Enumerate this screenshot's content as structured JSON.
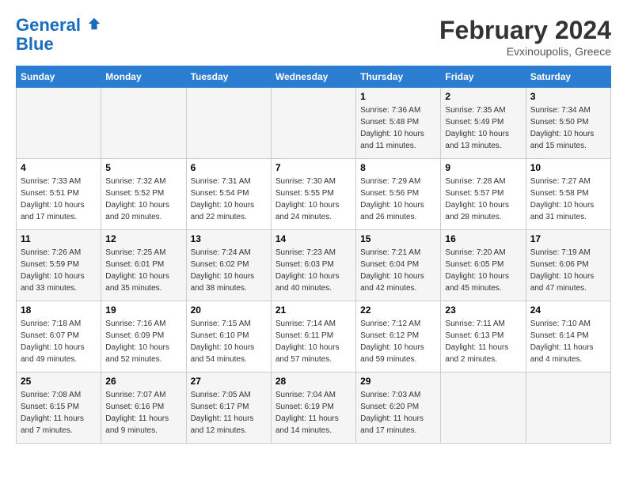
{
  "header": {
    "logo_line1": "General",
    "logo_line2": "Blue",
    "month_title": "February 2024",
    "location": "Evxinoupolis, Greece"
  },
  "weekdays": [
    "Sunday",
    "Monday",
    "Tuesday",
    "Wednesday",
    "Thursday",
    "Friday",
    "Saturday"
  ],
  "weeks": [
    [
      {
        "day": "",
        "info": ""
      },
      {
        "day": "",
        "info": ""
      },
      {
        "day": "",
        "info": ""
      },
      {
        "day": "",
        "info": ""
      },
      {
        "day": "1",
        "info": "Sunrise: 7:36 AM\nSunset: 5:48 PM\nDaylight: 10 hours\nand 11 minutes."
      },
      {
        "day": "2",
        "info": "Sunrise: 7:35 AM\nSunset: 5:49 PM\nDaylight: 10 hours\nand 13 minutes."
      },
      {
        "day": "3",
        "info": "Sunrise: 7:34 AM\nSunset: 5:50 PM\nDaylight: 10 hours\nand 15 minutes."
      }
    ],
    [
      {
        "day": "4",
        "info": "Sunrise: 7:33 AM\nSunset: 5:51 PM\nDaylight: 10 hours\nand 17 minutes."
      },
      {
        "day": "5",
        "info": "Sunrise: 7:32 AM\nSunset: 5:52 PM\nDaylight: 10 hours\nand 20 minutes."
      },
      {
        "day": "6",
        "info": "Sunrise: 7:31 AM\nSunset: 5:54 PM\nDaylight: 10 hours\nand 22 minutes."
      },
      {
        "day": "7",
        "info": "Sunrise: 7:30 AM\nSunset: 5:55 PM\nDaylight: 10 hours\nand 24 minutes."
      },
      {
        "day": "8",
        "info": "Sunrise: 7:29 AM\nSunset: 5:56 PM\nDaylight: 10 hours\nand 26 minutes."
      },
      {
        "day": "9",
        "info": "Sunrise: 7:28 AM\nSunset: 5:57 PM\nDaylight: 10 hours\nand 28 minutes."
      },
      {
        "day": "10",
        "info": "Sunrise: 7:27 AM\nSunset: 5:58 PM\nDaylight: 10 hours\nand 31 minutes."
      }
    ],
    [
      {
        "day": "11",
        "info": "Sunrise: 7:26 AM\nSunset: 5:59 PM\nDaylight: 10 hours\nand 33 minutes."
      },
      {
        "day": "12",
        "info": "Sunrise: 7:25 AM\nSunset: 6:01 PM\nDaylight: 10 hours\nand 35 minutes."
      },
      {
        "day": "13",
        "info": "Sunrise: 7:24 AM\nSunset: 6:02 PM\nDaylight: 10 hours\nand 38 minutes."
      },
      {
        "day": "14",
        "info": "Sunrise: 7:23 AM\nSunset: 6:03 PM\nDaylight: 10 hours\nand 40 minutes."
      },
      {
        "day": "15",
        "info": "Sunrise: 7:21 AM\nSunset: 6:04 PM\nDaylight: 10 hours\nand 42 minutes."
      },
      {
        "day": "16",
        "info": "Sunrise: 7:20 AM\nSunset: 6:05 PM\nDaylight: 10 hours\nand 45 minutes."
      },
      {
        "day": "17",
        "info": "Sunrise: 7:19 AM\nSunset: 6:06 PM\nDaylight: 10 hours\nand 47 minutes."
      }
    ],
    [
      {
        "day": "18",
        "info": "Sunrise: 7:18 AM\nSunset: 6:07 PM\nDaylight: 10 hours\nand 49 minutes."
      },
      {
        "day": "19",
        "info": "Sunrise: 7:16 AM\nSunset: 6:09 PM\nDaylight: 10 hours\nand 52 minutes."
      },
      {
        "day": "20",
        "info": "Sunrise: 7:15 AM\nSunset: 6:10 PM\nDaylight: 10 hours\nand 54 minutes."
      },
      {
        "day": "21",
        "info": "Sunrise: 7:14 AM\nSunset: 6:11 PM\nDaylight: 10 hours\nand 57 minutes."
      },
      {
        "day": "22",
        "info": "Sunrise: 7:12 AM\nSunset: 6:12 PM\nDaylight: 10 hours\nand 59 minutes."
      },
      {
        "day": "23",
        "info": "Sunrise: 7:11 AM\nSunset: 6:13 PM\nDaylight: 11 hours\nand 2 minutes."
      },
      {
        "day": "24",
        "info": "Sunrise: 7:10 AM\nSunset: 6:14 PM\nDaylight: 11 hours\nand 4 minutes."
      }
    ],
    [
      {
        "day": "25",
        "info": "Sunrise: 7:08 AM\nSunset: 6:15 PM\nDaylight: 11 hours\nand 7 minutes."
      },
      {
        "day": "26",
        "info": "Sunrise: 7:07 AM\nSunset: 6:16 PM\nDaylight: 11 hours\nand 9 minutes."
      },
      {
        "day": "27",
        "info": "Sunrise: 7:05 AM\nSunset: 6:17 PM\nDaylight: 11 hours\nand 12 minutes."
      },
      {
        "day": "28",
        "info": "Sunrise: 7:04 AM\nSunset: 6:19 PM\nDaylight: 11 hours\nand 14 minutes."
      },
      {
        "day": "29",
        "info": "Sunrise: 7:03 AM\nSunset: 6:20 PM\nDaylight: 11 hours\nand 17 minutes."
      },
      {
        "day": "",
        "info": ""
      },
      {
        "day": "",
        "info": ""
      }
    ]
  ]
}
